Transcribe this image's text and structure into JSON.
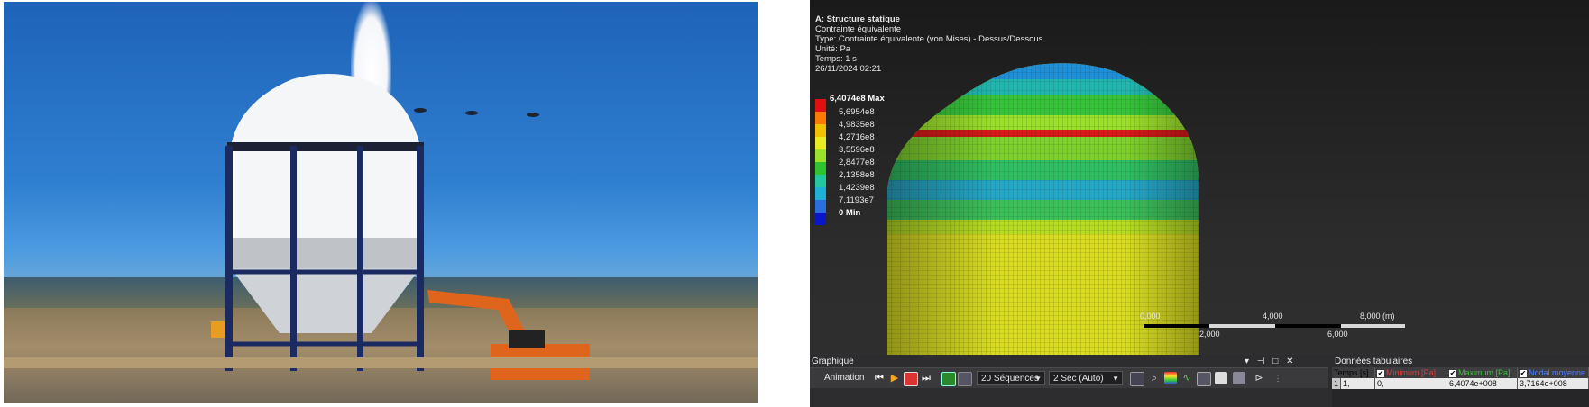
{
  "viewer": {
    "header": {
      "title": "A: Structure statique",
      "result": "Contrainte équivalente",
      "type": "Type: Contrainte équivalente (von Mises) - Dessus/Dessous",
      "unit": "Unité: Pa",
      "time": "Temps: 1 s",
      "date": "26/11/2024 02:21"
    },
    "legend": {
      "max_label": "6,4074e8 Max",
      "labels": [
        "5,6954e8",
        "4,9835e8",
        "4,2716e8",
        "3,5596e8",
        "2,8477e8",
        "2,1358e8",
        "1,4239e8",
        "7,1193e7"
      ],
      "min_label": "0 Min",
      "colors": [
        "#e01010",
        "#ff7a00",
        "#f2c200",
        "#e9ec22",
        "#9be32a",
        "#2fc42f",
        "#22c8a0",
        "#1fb0d8",
        "#2a6fe0",
        "#0a17c8"
      ]
    },
    "scale": {
      "top": [
        "0,000",
        "4,000",
        "8,000 (m)"
      ],
      "bottom": [
        "2,000",
        "6,000"
      ]
    }
  },
  "panel": {
    "graph_title": "Graphique",
    "graph_controls": "▾ ⊣ □ ✕",
    "animation_label": "Animation",
    "sequences": "20 Séquences",
    "speed": "2 Sec (Auto)",
    "table_title": "Données tabulaires",
    "table": {
      "headers": [
        "Temps [s]",
        "Minimum [Pa]",
        "Maximum [Pa]",
        "Nodal moyenne [Pa]"
      ],
      "header_colors": [
        "#e6e6e6",
        "#e23b3b",
        "#3fbf3f",
        "#4f7dff"
      ],
      "rows": [
        [
          "1",
          "1,",
          "0,",
          "6,4074e+008",
          "3,7164e+008"
        ]
      ]
    }
  }
}
